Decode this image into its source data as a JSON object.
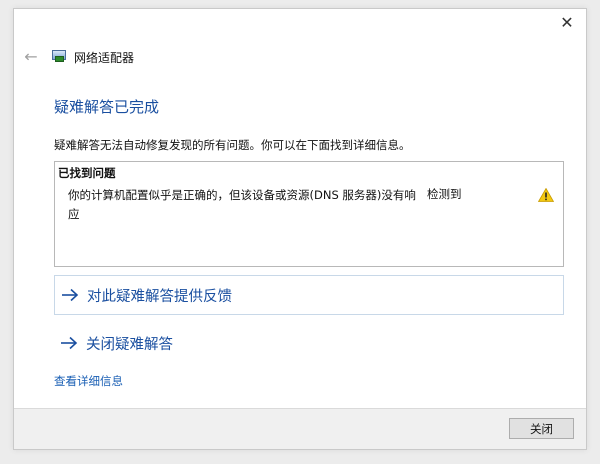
{
  "window": {
    "title": "网络适配器",
    "close_icon": "close-icon",
    "back_icon": "back-arrow-icon",
    "adapter_icon": "network-adapter-icon"
  },
  "main": {
    "title": "疑难解答已完成",
    "description": "疑难解答无法自动修复发现的所有问题。你可以在下面找到详细信息。"
  },
  "problems": {
    "header": "已找到问题",
    "items": [
      {
        "text": "你的计算机配置似乎是正确的，但该设备或资源(DNS 服务器)没有响应",
        "status": "检测到",
        "icon": "warning-icon"
      }
    ]
  },
  "links": {
    "feedback": "对此疑难解答提供反馈",
    "close_troubleshooter": "关闭疑难解答",
    "view_details": "查看详细信息",
    "arrow_icon": "arrow-right-icon"
  },
  "footer": {
    "close_label": "关闭"
  },
  "colors": {
    "accent": "#1a4fa0",
    "link": "#1a5fb4",
    "warning": "#f2c811"
  }
}
